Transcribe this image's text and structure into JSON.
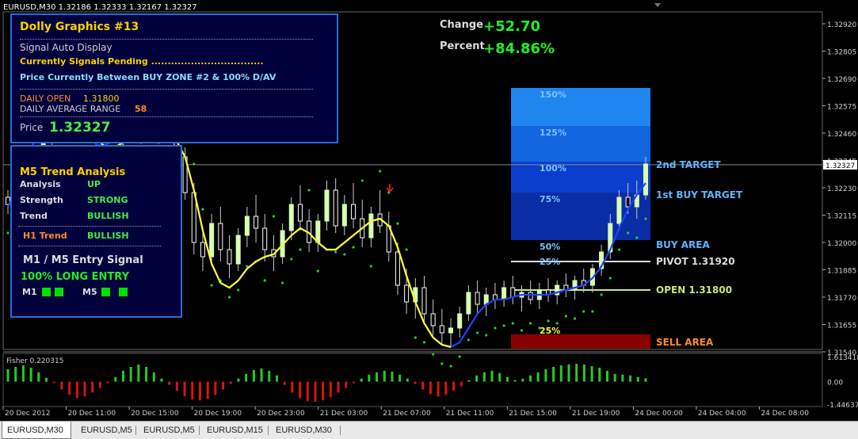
{
  "window": {
    "symbol_header": "EURUSD,M30  1.32186 1.32333 1.32167 1.32327"
  },
  "chart_data": {
    "type": "candlestick",
    "symbol": "EURUSD",
    "timeframe": "M30",
    "ylim": [
      1.3155,
      1.3297
    ],
    "price_axis_ticks": [
      "1.32920",
      "1.32805",
      "1.32690",
      "1.32575",
      "1.32460",
      "1.32345",
      "1.32230",
      "1.32115",
      "1.32000",
      "1.31885",
      "1.31770",
      "1.31655",
      "1.31540"
    ],
    "current_price_label": "1.32327",
    "time_axis_labels": [
      "20 Dec 2012",
      "20 Dec 11:00",
      "20 Dec 15:00",
      "20 Dec 19:00",
      "20 Dec 23:00",
      "21 Dec 03:00",
      "21 Dec 07:00",
      "21 Dec 11:00",
      "21 Dec 15:00",
      "21 Dec 19:00",
      "24 Dec 00:00",
      "24 Dec 04:00",
      "24 Dec 08:00"
    ],
    "indicator": {
      "name": "Fisher 0.220315",
      "ticks": [
        "1.613418",
        "0.00",
        "-1.446371"
      ],
      "ylim": [
        -1.446371,
        1.613418
      ],
      "values": [
        0.8,
        0.95,
        1.05,
        0.9,
        0.6,
        0.25,
        -0.1,
        -0.5,
        -0.85,
        -1.05,
        -0.95,
        -0.7,
        -0.4,
        -0.1,
        0.3,
        0.7,
        0.95,
        1.1,
        0.95,
        0.6,
        0.2,
        -0.2,
        -0.6,
        -0.95,
        -1.15,
        -1.2,
        -1.1,
        -0.85,
        -0.5,
        -0.15,
        0.2,
        0.5,
        0.75,
        0.85,
        0.7,
        0.4,
        -0.2,
        -0.7,
        -1.05,
        -1.25,
        -1.3,
        -1.2,
        -1.0,
        -0.7,
        -0.4,
        -0.1,
        0.2,
        0.45,
        0.6,
        0.7,
        0.65,
        0.45,
        0.2,
        -0.15,
        -0.5,
        -0.8,
        -0.95,
        -0.85,
        -0.6,
        -0.3,
        0.1,
        0.4,
        0.6,
        0.7,
        0.55,
        0.3,
        0.1,
        0.2,
        0.4,
        0.6,
        0.8,
        0.95,
        1.05,
        1.12,
        1.15,
        1.1,
        1.0,
        0.9,
        0.7,
        0.5,
        0.45,
        0.4,
        0.3,
        0.22
      ]
    },
    "candles": [
      [
        1.3219,
        1.3222,
        1.3212,
        1.3216
      ],
      [
        1.3216,
        1.3226,
        1.3213,
        1.3224
      ],
      [
        1.3224,
        1.3233,
        1.3221,
        1.323
      ],
      [
        1.323,
        1.324,
        1.3227,
        1.3237
      ],
      [
        1.3237,
        1.3246,
        1.3233,
        1.3243
      ],
      [
        1.3243,
        1.3252,
        1.324,
        1.3249
      ],
      [
        1.3249,
        1.3258,
        1.3245,
        1.3255
      ],
      [
        1.3255,
        1.3262,
        1.325,
        1.3254
      ],
      [
        1.3254,
        1.3261,
        1.3247,
        1.325
      ],
      [
        1.325,
        1.3259,
        1.3246,
        1.3256
      ],
      [
        1.3256,
        1.3263,
        1.3251,
        1.3253
      ],
      [
        1.3253,
        1.326,
        1.3248,
        1.3257
      ],
      [
        1.3257,
        1.3264,
        1.3252,
        1.3255
      ],
      [
        1.3255,
        1.3261,
        1.3249,
        1.3252
      ],
      [
        1.3252,
        1.3258,
        1.3247,
        1.3256
      ],
      [
        1.3256,
        1.3263,
        1.325,
        1.3253
      ],
      [
        1.3253,
        1.3259,
        1.3248,
        1.3255
      ],
      [
        1.3255,
        1.3262,
        1.325,
        1.3254
      ],
      [
        1.3254,
        1.3258,
        1.3243,
        1.3246
      ],
      [
        1.3246,
        1.3252,
        1.3233,
        1.3236
      ],
      [
        1.3236,
        1.324,
        1.3218,
        1.3221
      ],
      [
        1.3221,
        1.3225,
        1.3195,
        1.32
      ],
      [
        1.32,
        1.3206,
        1.3188,
        1.3194
      ],
      [
        1.3194,
        1.3212,
        1.319,
        1.3208
      ],
      [
        1.3208,
        1.3215,
        1.3192,
        1.3197
      ],
      [
        1.3197,
        1.3203,
        1.3185,
        1.3191
      ],
      [
        1.3191,
        1.3206,
        1.3188,
        1.3203
      ],
      [
        1.3203,
        1.3215,
        1.3198,
        1.3211
      ],
      [
        1.3211,
        1.322,
        1.32,
        1.3206
      ],
      [
        1.3206,
        1.3212,
        1.3192,
        1.3197
      ],
      [
        1.3197,
        1.3203,
        1.3188,
        1.3194
      ],
      [
        1.3194,
        1.3208,
        1.3191,
        1.3205
      ],
      [
        1.3205,
        1.3219,
        1.3201,
        1.3216
      ],
      [
        1.3216,
        1.3224,
        1.3205,
        1.3209
      ],
      [
        1.3209,
        1.3214,
        1.3196,
        1.32
      ],
      [
        1.32,
        1.3212,
        1.3196,
        1.3209
      ],
      [
        1.3209,
        1.3226,
        1.3205,
        1.3222
      ],
      [
        1.3222,
        1.3227,
        1.3204,
        1.3207
      ],
      [
        1.3207,
        1.322,
        1.3203,
        1.3216
      ],
      [
        1.3216,
        1.3225,
        1.3206,
        1.321
      ],
      [
        1.321,
        1.3218,
        1.3198,
        1.3202
      ],
      [
        1.3202,
        1.3215,
        1.3198,
        1.3212
      ],
      [
        1.3212,
        1.3222,
        1.3204,
        1.3207
      ],
      [
        1.3207,
        1.3213,
        1.3192,
        1.3196
      ],
      [
        1.3196,
        1.32,
        1.3178,
        1.3182
      ],
      [
        1.3182,
        1.3189,
        1.317,
        1.3175
      ],
      [
        1.3175,
        1.3185,
        1.3168,
        1.3181
      ],
      [
        1.3181,
        1.3186,
        1.3166,
        1.317
      ],
      [
        1.317,
        1.3176,
        1.3161,
        1.3165
      ],
      [
        1.3165,
        1.3172,
        1.3157,
        1.3162
      ],
      [
        1.3162,
        1.3168,
        1.3156,
        1.3164
      ],
      [
        1.3164,
        1.3173,
        1.316,
        1.317
      ],
      [
        1.317,
        1.3182,
        1.3167,
        1.3179
      ],
      [
        1.3179,
        1.3184,
        1.317,
        1.3174
      ],
      [
        1.3174,
        1.3181,
        1.3169,
        1.3178
      ],
      [
        1.3178,
        1.3183,
        1.3172,
        1.3176
      ],
      [
        1.3176,
        1.3184,
        1.3173,
        1.3181
      ],
      [
        1.3181,
        1.3186,
        1.3174,
        1.3177
      ],
      [
        1.3177,
        1.3182,
        1.3171,
        1.3179
      ],
      [
        1.3179,
        1.3184,
        1.3174,
        1.3176
      ],
      [
        1.3176,
        1.3183,
        1.3172,
        1.318
      ],
      [
        1.318,
        1.3185,
        1.3175,
        1.3178
      ],
      [
        1.3178,
        1.3184,
        1.3174,
        1.3182
      ],
      [
        1.3182,
        1.3187,
        1.3177,
        1.318
      ],
      [
        1.318,
        1.3186,
        1.3176,
        1.3184
      ],
      [
        1.3184,
        1.3189,
        1.3179,
        1.3182
      ],
      [
        1.3182,
        1.3191,
        1.3179,
        1.3189
      ],
      [
        1.3189,
        1.3199,
        1.3186,
        1.3196
      ],
      [
        1.3196,
        1.3212,
        1.3193,
        1.3208
      ],
      [
        1.3208,
        1.3222,
        1.3205,
        1.3219
      ],
      [
        1.3219,
        1.3225,
        1.3212,
        1.3215
      ],
      [
        1.3215,
        1.3226,
        1.321,
        1.322
      ],
      [
        1.322,
        1.3236,
        1.3218,
        1.3233
      ]
    ],
    "blue_ma": [
      1.3215,
      1.3222,
      1.3232,
      1.3243,
      1.3254,
      1.3263,
      1.3271,
      1.3272,
      1.3262,
      1.3248,
      1.3241,
      1.3241,
      1.3243,
      1.3246,
      1.3247,
      1.3247,
      1.3246,
      1.3246,
      1.3245,
      1.3243,
      1.3236,
      1.3222,
      1.3205,
      1.3191,
      1.3183,
      1.3181,
      1.3184,
      1.3189,
      1.3192,
      1.3194,
      1.3195,
      1.3199,
      1.3203,
      1.3206,
      1.3204,
      1.32,
      1.3197,
      1.3197,
      1.32,
      1.3203,
      1.3206,
      1.3209,
      1.321,
      1.3207,
      1.3198,
      1.3186,
      1.3175,
      1.3166,
      1.316,
      1.3157,
      1.3156,
      1.3158,
      1.3164,
      1.317,
      1.3174,
      1.3176,
      1.3176,
      1.3177,
      1.3178,
      1.3178,
      1.3178,
      1.3178,
      1.3179,
      1.318,
      1.3181,
      1.3182,
      1.3185,
      1.319,
      1.3197,
      1.3206,
      1.3214,
      1.322,
      1.3225
    ],
    "yellow_ma": [
      null,
      null,
      null,
      null,
      null,
      null,
      null,
      1.3282,
      1.327,
      1.3255,
      1.3244,
      1.324,
      1.324,
      1.3242,
      1.3244,
      1.3245,
      1.3246,
      1.3247,
      1.3246,
      1.3243,
      1.3236,
      1.3222,
      1.3205,
      1.3191,
      1.3183,
      1.3181,
      1.3184,
      1.3189,
      1.3192,
      1.3194,
      1.3195,
      1.3199,
      1.3203,
      1.3206,
      1.3204,
      1.32,
      1.3197,
      1.3197,
      1.32,
      1.3203,
      1.3206,
      1.3209,
      1.321,
      1.3207,
      1.3198,
      1.3186,
      1.3175,
      1.3166,
      1.316,
      1.3157,
      1.3156,
      null,
      null,
      null,
      null,
      null,
      null,
      null,
      null,
      null,
      null,
      null,
      null,
      null,
      null,
      null,
      null,
      null,
      null,
      null,
      null,
      null,
      null
    ],
    "overlay": {
      "change_label": "Change",
      "change_value": "+52.70",
      "percent_label": "Percent",
      "percent_value": "+84.86%",
      "zones": [
        {
          "label": "150%",
          "color": "#1e86ee",
          "price": 1.3265
        },
        {
          "label": "125%",
          "color": "#1266e0",
          "price": 1.3249
        },
        {
          "label": "100%",
          "color": "#0b3ecc",
          "price": 1.3234
        },
        {
          "label": "75%",
          "color": "#0a2da6",
          "price": 1.3221
        },
        {
          "label": "50%",
          "color": "#071d85",
          "price": 1.3201
        }
      ],
      "zone_top_price": 1.3265,
      "zone_bottom_price": 1.3201,
      "lines": [
        {
          "label": "2nd TARGET",
          "price": 1.32327,
          "color": "#5fb4ff"
        },
        {
          "label": "1st BUY TARGET",
          "price": 1.322,
          "color": "#5fb4ff"
        },
        {
          "label": "BUY AREA",
          "price": 1.3199,
          "color": "#5fb4ff"
        },
        {
          "label": "PIVOT 1.31920",
          "price": 1.3192,
          "color": "#dddddd"
        },
        {
          "label": "OPEN 1.31800",
          "price": 1.318,
          "color": "#c8e87a"
        },
        {
          "label": "SELL AREA",
          "price": 1.3158,
          "color": "#ff8a2a"
        }
      ],
      "pivot_pct_label": "25%",
      "low_pct_label": "25%"
    }
  },
  "dolly_panel": {
    "title": "Dolly Graphics #13",
    "signal_auto": "Signal Auto Display",
    "signals_pending": "Currently Signals Pending ..................................",
    "price_between": "Price Currently Between BUY ZONE #2 & 100% D/AV",
    "daily_open_label": "DAILY OPEN",
    "daily_open_value": "1.31800",
    "dar_label": "DAILY AVERAGE RANGE",
    "dar_value": "58",
    "price_label": "Price",
    "price_value": "1.32327"
  },
  "trend_panel": {
    "title": "M5 Trend Analysis",
    "rows": [
      {
        "label": "Analysis",
        "value": "UP"
      },
      {
        "label": "Strength",
        "value": "STRONG"
      },
      {
        "label": "Trend",
        "value": "BULLISH"
      }
    ],
    "h1_label": "H1 Trend",
    "h1_value": "BULLISH",
    "entry_title": "M1 /  M5 Entry Signal",
    "entry_value": "100% LONG ENTRY",
    "m1_label": "M1",
    "m5_label": "M5"
  },
  "tabs": [
    "EURUSD,M30",
    "EURUSD,M5",
    "EURUSD,M5",
    "EURUSD,M15",
    "EURUSD,M30"
  ],
  "colors": {
    "bull_candle": "#d8ffb0",
    "bear_candle": "#ffffff",
    "blue_ma": "#2040ff",
    "yellow_ma": "#ffff30",
    "sar_dots": "#22cc33",
    "fisher_up": "#22cc22",
    "fisher_down": "#dd1111"
  }
}
